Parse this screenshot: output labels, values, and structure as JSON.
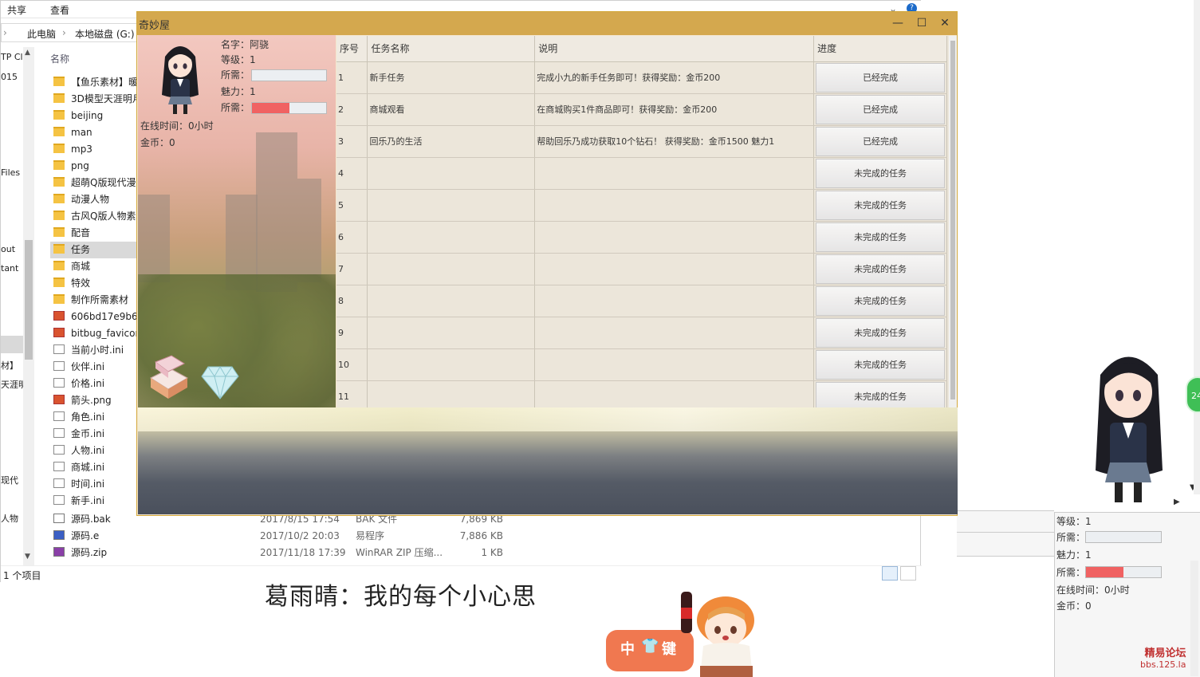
{
  "explorer": {
    "ribbon_tabs": [
      "共享",
      "查看"
    ],
    "help_icon": "?",
    "breadcrumb": [
      "此电脑",
      "本地磁盘 (G:)"
    ],
    "left_nav": [
      "TP Cl",
      "015",
      "Files",
      "out",
      "tant",
      "材】",
      "天涯明",
      "现代",
      "人物"
    ],
    "column_name": "名称",
    "files": [
      {
        "name": "【鱼乐素材】暖暖",
        "icon": "folder"
      },
      {
        "name": "3D模型天涯明月",
        "icon": "folder"
      },
      {
        "name": "beijing",
        "icon": "folder"
      },
      {
        "name": "man",
        "icon": "folder"
      },
      {
        "name": "mp3",
        "icon": "folder"
      },
      {
        "name": "png",
        "icon": "folder"
      },
      {
        "name": "超萌Q版现代漫画",
        "icon": "folder"
      },
      {
        "name": "动漫人物",
        "icon": "folder"
      },
      {
        "name": "古风Q版人物素材",
        "icon": "folder"
      },
      {
        "name": "配音",
        "icon": "folder"
      },
      {
        "name": "任务",
        "icon": "folder",
        "selected": true
      },
      {
        "name": "商城",
        "icon": "folder"
      },
      {
        "name": "特效",
        "icon": "folder"
      },
      {
        "name": "制作所需素材",
        "icon": "folder"
      },
      {
        "name": "606bd17e9b6a",
        "icon": "png"
      },
      {
        "name": "bitbug_favicon.",
        "icon": "png"
      },
      {
        "name": "当前小时.ini",
        "icon": "doc"
      },
      {
        "name": "伙伴.ini",
        "icon": "doc"
      },
      {
        "name": "价格.ini",
        "icon": "doc"
      },
      {
        "name": "箭头.png",
        "icon": "png"
      },
      {
        "name": "角色.ini",
        "icon": "doc"
      },
      {
        "name": "金币.ini",
        "icon": "doc"
      },
      {
        "name": "人物.ini",
        "icon": "doc"
      },
      {
        "name": "商城.ini",
        "icon": "doc"
      },
      {
        "name": "时间.ini",
        "icon": "doc"
      },
      {
        "name": "新手.ini",
        "icon": "doc"
      }
    ],
    "bottom_files": [
      {
        "name": "源码.bak",
        "date": "2017/8/15 17:54",
        "type": "BAK 文件",
        "size": "7,869 KB"
      },
      {
        "name": "源码.e",
        "date": "2017/10/2 20:03",
        "type": "易程序",
        "size": "7,886 KB"
      },
      {
        "name": "源码.zip",
        "date": "2017/11/18 17:39",
        "type": "WinRAR ZIP 压缩...",
        "size": "1 KB"
      }
    ],
    "status": "1 个项目"
  },
  "game": {
    "title": "奇妙屋",
    "stats": {
      "name": "名字：阿骁",
      "level": "等级：1",
      "exp_label": "所需：",
      "charm": "魅力：1",
      "hp_label": "所需：",
      "online": "在线时间：0小时",
      "gold": "金币：0"
    },
    "exp_fraction": 0,
    "hp_fraction": 0.5,
    "table_headers": [
      "序号",
      "任务名称",
      "说明",
      "进度"
    ],
    "tasks": [
      {
        "id": "1",
        "name": "新手任务",
        "desc": "完成小九的新手任务即可！获得奖励：金币200",
        "status": "已经完成"
      },
      {
        "id": "2",
        "name": "商城观看",
        "desc": "在商城购买1件商品即可！获得奖励：金币200",
        "status": "已经完成"
      },
      {
        "id": "3",
        "name": "回乐乃的生活",
        "desc": "帮助回乐乃成功获取10个钻石！ 获得奖励：金币1500 魅力1",
        "status": "已经完成"
      },
      {
        "id": "4",
        "name": "",
        "desc": "",
        "status": "未完成的任务"
      },
      {
        "id": "5",
        "name": "",
        "desc": "",
        "status": "未完成的任务"
      },
      {
        "id": "6",
        "name": "",
        "desc": "",
        "status": "未完成的任务"
      },
      {
        "id": "7",
        "name": "",
        "desc": "",
        "status": "未完成的任务"
      },
      {
        "id": "8",
        "name": "",
        "desc": "",
        "status": "未完成的任务"
      },
      {
        "id": "9",
        "name": "",
        "desc": "",
        "status": "未完成的任务"
      },
      {
        "id": "10",
        "name": "",
        "desc": "",
        "status": "未完成的任务"
      },
      {
        "id": "11",
        "name": "",
        "desc": "",
        "status": "未完成的任务"
      }
    ],
    "window_buttons": {
      "minimize": "—",
      "maximize": "☐",
      "close": "✕"
    }
  },
  "right_panel": {
    "level": "等级：1",
    "exp_label": "所需：",
    "charm": "魅力：1",
    "hp_label": "所需：",
    "online": "在线时间：0小时",
    "gold": "金币：0",
    "hp_fraction": 0.5
  },
  "side_button": "24",
  "subtitle": "葛雨晴：我的每个小心思",
  "watermark": {
    "line1": "精易论坛",
    "line2": "bbs.125.la"
  },
  "ime_badge": {
    "char1": "中",
    "char2": "键"
  },
  "colors": {
    "title_bar": "#d4a84e",
    "hp_bar": "#f06262",
    "accent": "#0078d7"
  }
}
